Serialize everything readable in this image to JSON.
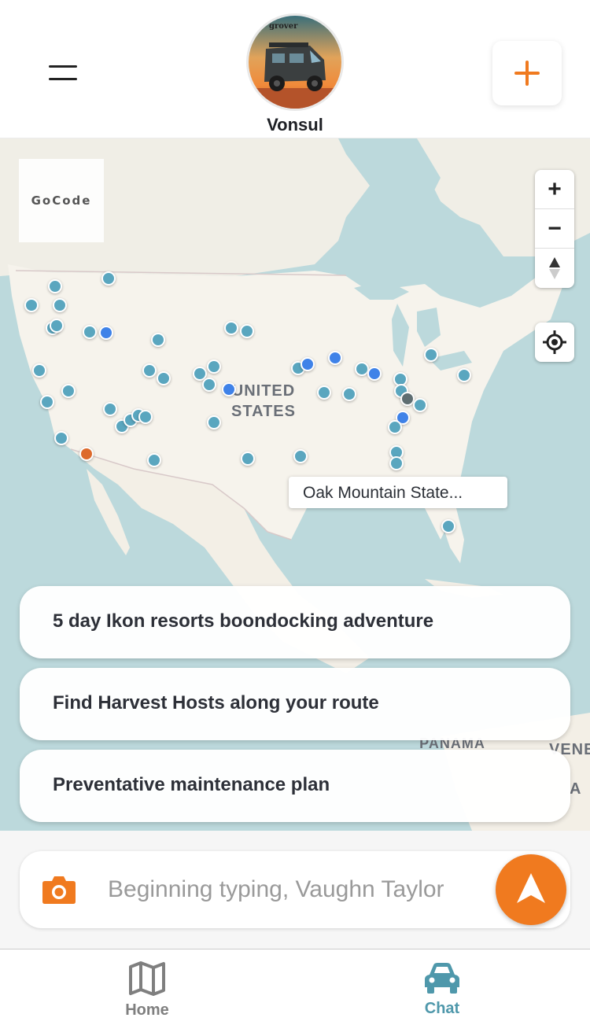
{
  "header": {
    "avatar_caption": "grover",
    "vehicle_name": "Vonsul"
  },
  "map": {
    "brand": "GoCode",
    "country_label_line1": "UNITED",
    "country_label_line2": "STATES",
    "partial_label_1": "PANAMA",
    "partial_label_2": "VENE",
    "partial_label_3": "A",
    "tooltip": "Oak Mountain State...",
    "zoom_in": "+",
    "zoom_out": "−",
    "colors": {
      "teal_marker": "#5aa6bf",
      "blue_marker": "#3f82e8",
      "orange_marker": "#dd6a2c",
      "land": "#f5f2ea",
      "water": "#bcd9dc"
    },
    "marker_count": 73
  },
  "suggestions": [
    {
      "label": "5 day Ikon resorts boondocking adventure"
    },
    {
      "label": "Find Harvest Hosts along your route"
    },
    {
      "label": "Preventative maintenance plan"
    }
  ],
  "chat": {
    "placeholder": "Beginning typing, Vaughn Taylor",
    "accent": "#f07a1f"
  },
  "nav": {
    "items": [
      {
        "label": "Home",
        "icon": "map-icon",
        "active": false
      },
      {
        "label": "Chat",
        "icon": "car-icon",
        "active": true
      }
    ],
    "active_color": "#4f98ab"
  }
}
